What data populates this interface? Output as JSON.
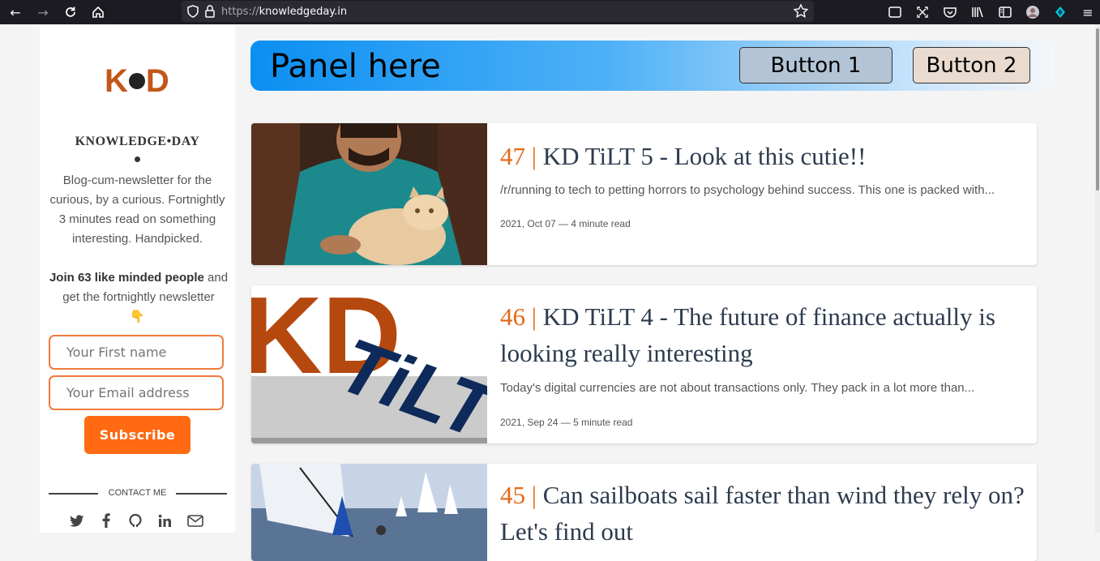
{
  "browser": {
    "url_proto": "https://",
    "url_host": "knowledgeday.in"
  },
  "sidebar": {
    "logo_text_left": "K",
    "logo_text_right": "D",
    "brand": "KNOWLEDGE•DAY",
    "description": "Blog-cum-newsletter for the curious, by a curious. Fortnightly 3 minutes read on something interesting. Handpicked.",
    "join_bold": "Join 63 like minded people",
    "join_rest": " and get the fortnightly newsletter",
    "first_name_placeholder": "Your First name",
    "email_placeholder": "Your Email address",
    "subscribe_label": "Subscribe",
    "contact_label": "CONTACT ME",
    "socials": [
      "twitter-icon",
      "facebook-icon",
      "github-icon",
      "linkedin-icon",
      "mail-icon"
    ]
  },
  "panel": {
    "title": "Panel here",
    "button1": "Button 1",
    "button2": "Button 2"
  },
  "posts": [
    {
      "number": "47",
      "sep": " | ",
      "title": "KD TiLT 5 - Look at this cutie!!",
      "excerpt": "/r/running to tech to petting horrors to psychology behind success. This one is packed with...",
      "date": "2021, Oct 07",
      "read": "4 minute read"
    },
    {
      "number": "46",
      "sep": " | ",
      "title": "KD TiLT 4 - The future of finance actually is looking really interesting",
      "excerpt": "Today's digital currencies are not about transactions only. They pack in a lot more than...",
      "date": "2021, Sep 24",
      "read": "5 minute read",
      "thumb_text_kd": "KD",
      "thumb_text_tilt": "TiLT"
    },
    {
      "number": "45",
      "sep": " | ",
      "title": "Can sailboats sail faster than wind they rely on? Let's find out"
    }
  ],
  "colors": {
    "accent": "#ff6a13",
    "number": "#e56717",
    "title": "#2d3b4e"
  }
}
